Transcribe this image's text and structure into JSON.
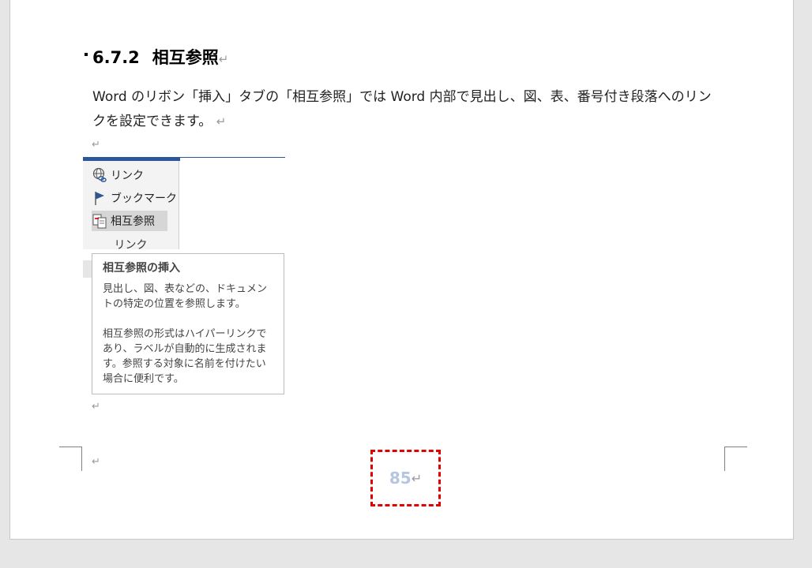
{
  "section": {
    "number": "6.7.2",
    "title": "相互参照"
  },
  "paragraph_mark": "↵",
  "body_text": "Word のリボン「挿入」タブの「相互参照」では Word 内部で見出し、図、表、番号付き段落へのリンクを設定できます。",
  "ribbon": {
    "items": [
      {
        "label": "リンク",
        "icon": "link-icon"
      },
      {
        "label": "ブックマーク",
        "icon": "bookmark-flag-icon"
      },
      {
        "label": "相互参照",
        "icon": "cross-reference-icon"
      }
    ],
    "group_label": "リンク"
  },
  "tooltip": {
    "title": "相互参照の挿入",
    "line1": "見出し、図、表などの、ドキュメントの特定の位置を参照します。",
    "line2": "相互参照の形式はハイパーリンクであり、ラベルが自動的に生成されます。参照する対象に名前を付けたい場合に便利です。"
  },
  "footer": {
    "page_number": "85"
  },
  "colors": {
    "accent": "#2b579a",
    "highlight_box": "#e00000",
    "page_number": "#b4c6e0"
  }
}
